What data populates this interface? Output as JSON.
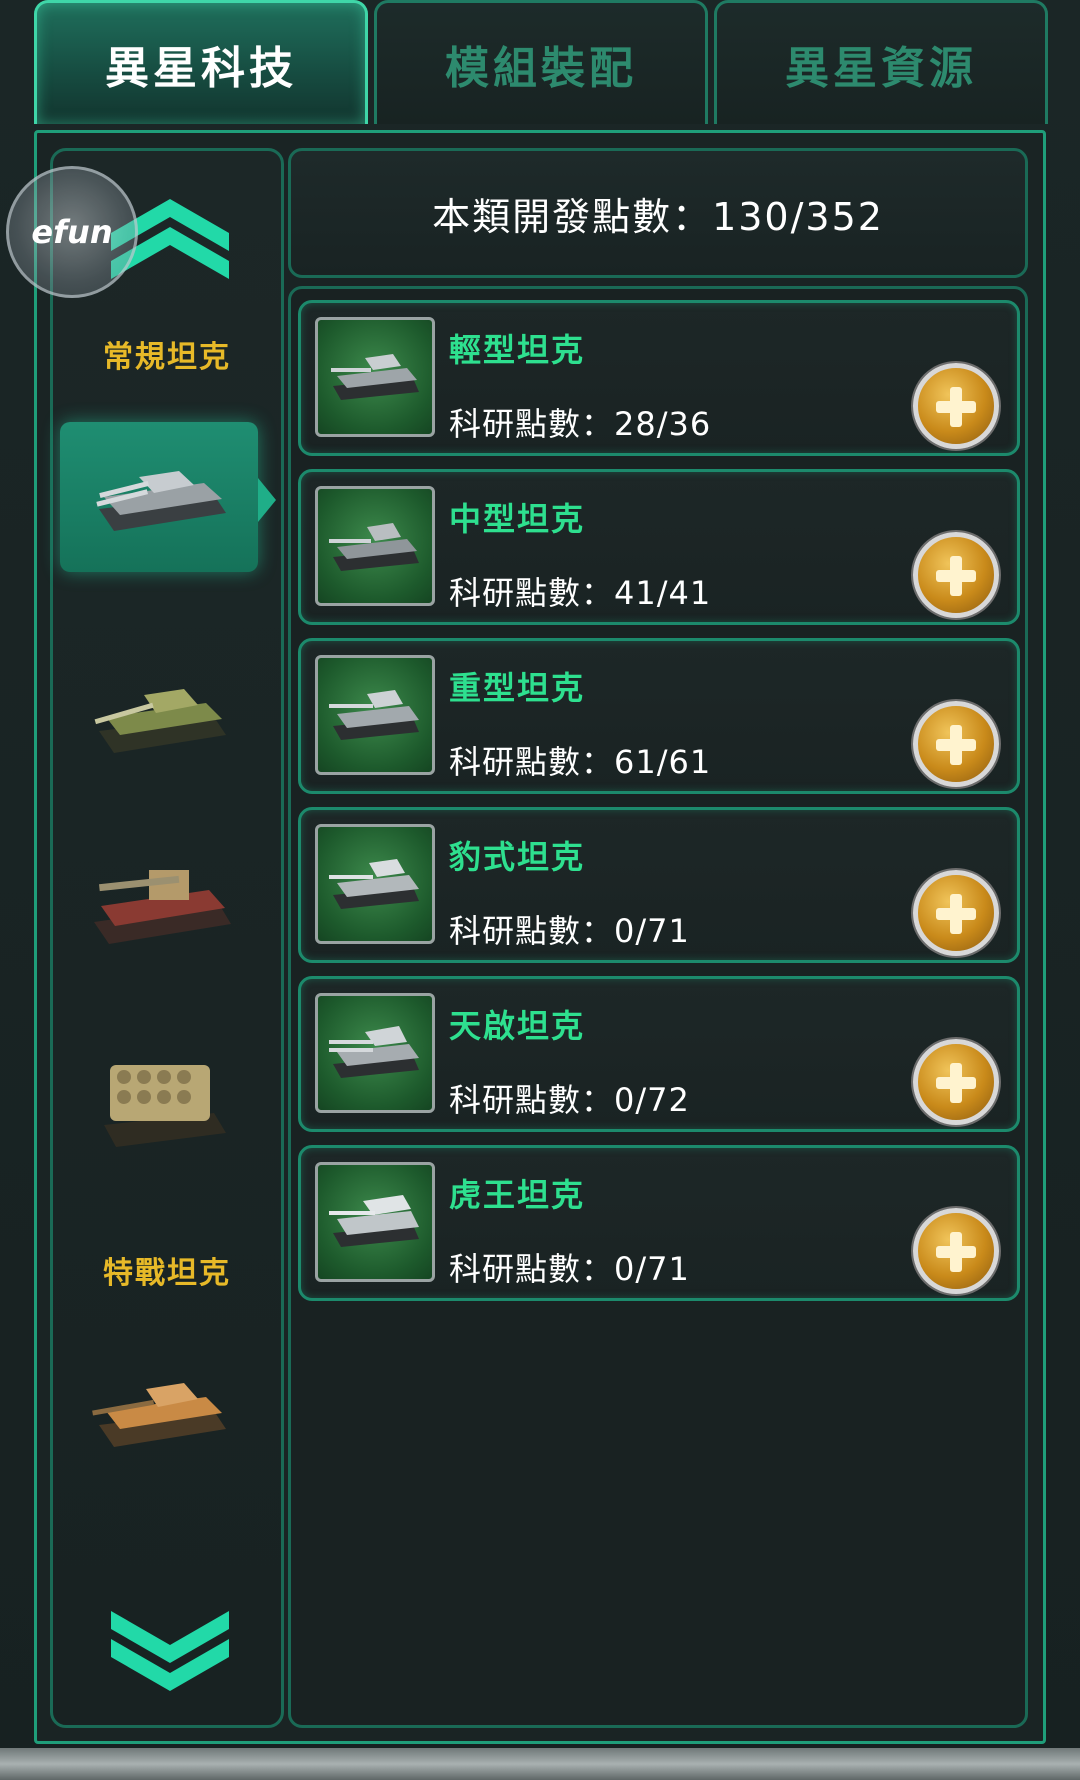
{
  "tabs": [
    {
      "label": "異星科技",
      "active": true
    },
    {
      "label": "模組裝配",
      "active": false
    },
    {
      "label": "異星資源",
      "active": false
    }
  ],
  "overlay": {
    "label": "efun"
  },
  "sidebar": {
    "categories": [
      {
        "label": "常規坦克"
      },
      {
        "label": "特戰坦克"
      }
    ],
    "selected_index": 0
  },
  "header": {
    "dev_points": "本類開發點數：130/352"
  },
  "tanks": [
    {
      "name": "輕型坦克",
      "points": "科研點數：28/36"
    },
    {
      "name": "中型坦克",
      "points": "科研點數：41/41"
    },
    {
      "name": "重型坦克",
      "points": "科研點數：61/61"
    },
    {
      "name": "豹式坦克",
      "points": "科研點數：0/71"
    },
    {
      "name": "天啟坦克",
      "points": "科研點數：0/72"
    },
    {
      "name": "虎王坦克",
      "points": "科研點數：0/71"
    }
  ],
  "colors": {
    "accent": "#1f9e7a",
    "tank_name": "#2ee08f",
    "category_label": "#e7b928",
    "plus_button": "#c98a1a"
  }
}
